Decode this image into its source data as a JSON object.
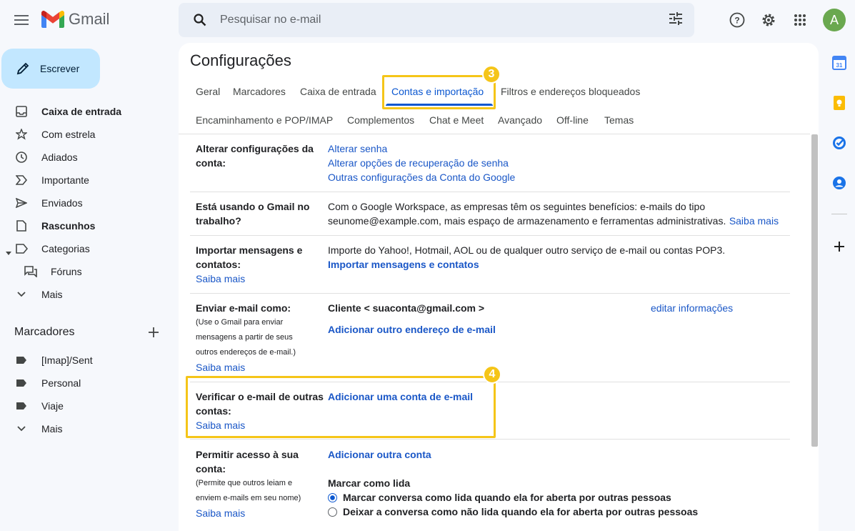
{
  "app": {
    "name": "Gmail"
  },
  "search": {
    "placeholder": "Pesquisar no e-mail"
  },
  "user": {
    "avatar_letter": "A"
  },
  "compose": {
    "label": "Escrever"
  },
  "nav": {
    "items": [
      {
        "label": "Caixa de entrada",
        "icon": "inbox-icon",
        "bold": true
      },
      {
        "label": "Com estrela",
        "icon": "star-icon",
        "bold": false
      },
      {
        "label": "Adiados",
        "icon": "clock-icon",
        "bold": false
      },
      {
        "label": "Importante",
        "icon": "important-icon",
        "bold": false
      },
      {
        "label": "Enviados",
        "icon": "send-icon",
        "bold": false
      },
      {
        "label": "Rascunhos",
        "icon": "draft-icon",
        "bold": true
      },
      {
        "label": "Categorias",
        "icon": "label-outline-icon",
        "bold": false
      },
      {
        "label": "Fóruns",
        "icon": "forum-icon",
        "bold": false
      },
      {
        "label": "Mais",
        "icon": "chevron-down-icon",
        "bold": false
      }
    ],
    "labels_title": "Marcadores",
    "labels": [
      {
        "label": "[Imap]/Sent"
      },
      {
        "label": "Personal"
      },
      {
        "label": "Viaje"
      }
    ],
    "labels_more": "Mais"
  },
  "settings": {
    "title": "Configurações",
    "tabs_row1": [
      "Geral",
      "Marcadores",
      "Caixa de entrada",
      "Contas e importação",
      "Filtros e endereços bloqueados"
    ],
    "tabs_row2": [
      "Encaminhamento e POP/IMAP",
      "Complementos",
      "Chat e Meet",
      "Avançado",
      "Off-line",
      "Temas"
    ],
    "active_tab": "Contas e importação",
    "badges": [
      "3",
      "4"
    ],
    "rows": {
      "account": {
        "label": "Alterar configurações da conta:",
        "links": [
          "Alterar senha",
          "Alterar opções de recuperação de senha",
          "Outras configurações da Conta do Google"
        ]
      },
      "work": {
        "label": "Está usando o Gmail no trabalho?",
        "text1": "Com o Google Workspace, as empresas têm os seguintes benefícios: e-mails do tipo",
        "text2": "seunome@example.com, mais espaço de armazenamento e ferramentas administrativas.",
        "learn_more": "Saiba mais"
      },
      "import": {
        "label": "Importar mensagens e contatos:",
        "learn_more": "Saiba mais",
        "text": "Importe do Yahoo!, Hotmail, AOL ou de qualquer outro serviço de e-mail ou contas POP3.",
        "action": "Importar mensagens e contatos"
      },
      "send_as": {
        "label": "Enviar e-mail como:",
        "sub": [
          "(Use o Gmail para enviar",
          "mensagens a partir de seus",
          "outros endereços de e-mail.)"
        ],
        "learn_more": "Saiba mais",
        "address": "Cliente < suaconta@gmail.com >",
        "edit": "editar informações",
        "action": "Adicionar outro endereço de e-mail"
      },
      "check": {
        "label": "Verificar o e-mail de outras contas:",
        "learn_more": "Saiba mais",
        "action": "Adicionar uma conta de e-mail"
      },
      "grant": {
        "label": "Permitir acesso à sua conta:",
        "sub": [
          "(Permite que outros leiam e",
          "enviem e-mails em seu nome)"
        ],
        "learn_more": "Saiba mais",
        "action": "Adicionar outra conta",
        "mark_title": "Marcar como lida",
        "option1": "Marcar conversa como lida quando ela for aberta por outras pessoas",
        "option2": "Deixar a conversa como não lida quando ela for aberta por outras pessoas"
      }
    }
  },
  "colors": {
    "accent": "#0b57d0",
    "highlight": "#f5c518",
    "compose_bg": "#c2e7ff"
  }
}
